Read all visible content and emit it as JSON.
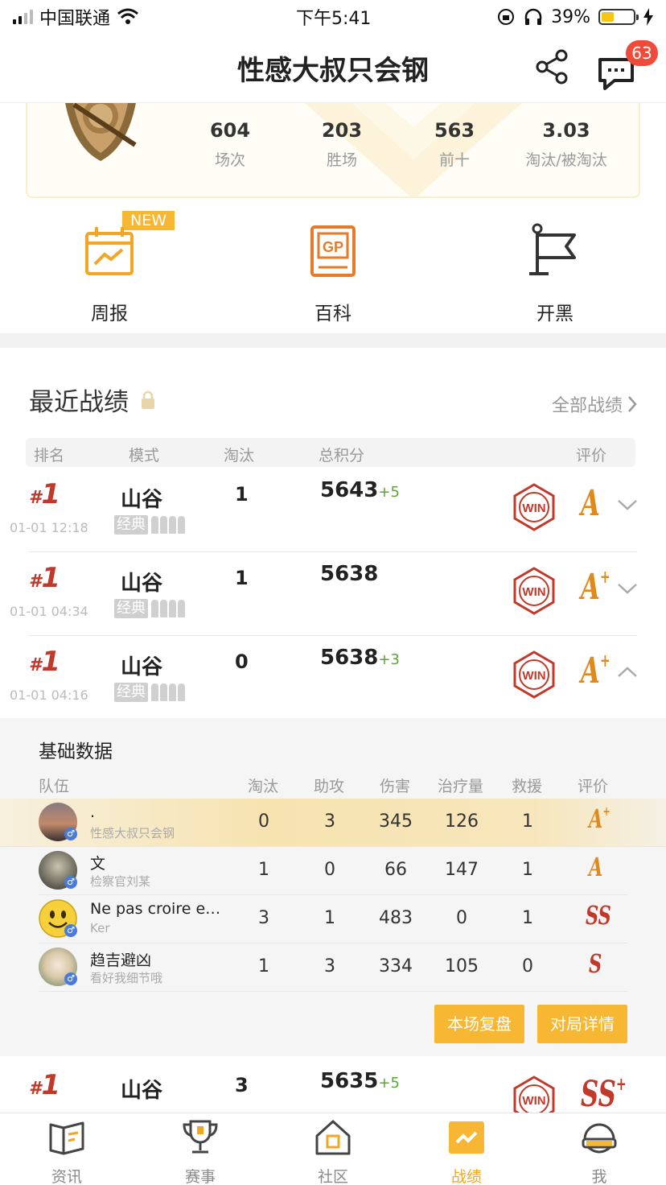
{
  "status_bar": {
    "carrier": "中国联通",
    "time": "下午5:41",
    "battery": "39%"
  },
  "header": {
    "title": "性感大叔只会钢",
    "badge_count": "63"
  },
  "stats": [
    {
      "value": "604",
      "label": "场次"
    },
    {
      "value": "203",
      "label": "胜场"
    },
    {
      "value": "563",
      "label": "前十"
    },
    {
      "value": "3.03",
      "label": "淘汰/被淘汰"
    }
  ],
  "shortcuts": {
    "new_tag": "NEW",
    "items": [
      "周报",
      "百科",
      "开黑"
    ],
    "gp_text": "GP"
  },
  "recent": {
    "title": "最近战绩",
    "all_link": "全部战绩",
    "columns": [
      "排名",
      "模式",
      "淘汰",
      "总积分",
      "评价"
    ],
    "win_text": "WIN",
    "rows": [
      {
        "rank_hash": "#",
        "rank": "1",
        "time": "01-01 12:18",
        "map": "山谷",
        "mode": "经典",
        "kills": "1",
        "score": "5643",
        "delta": "+5",
        "grade": "A",
        "grade_sup": ""
      },
      {
        "rank_hash": "#",
        "rank": "1",
        "time": "01-01 04:34",
        "map": "山谷",
        "mode": "经典",
        "kills": "1",
        "score": "5638",
        "delta": "",
        "grade": "A",
        "grade_sup": "+"
      },
      {
        "rank_hash": "#",
        "rank": "1",
        "time": "01-01 04:16",
        "map": "山谷",
        "mode": "经典",
        "kills": "0",
        "score": "5638",
        "delta": "+3",
        "grade": "A",
        "grade_sup": "+"
      },
      {
        "rank_hash": "#",
        "rank": "1",
        "time": "",
        "map": "山谷",
        "mode": "",
        "kills": "3",
        "score": "5635",
        "delta": "+5",
        "grade": "SS",
        "grade_sup": "+"
      }
    ]
  },
  "detail": {
    "title": "基础数据",
    "columns": [
      "队伍",
      "淘汰",
      "助攻",
      "伤害",
      "治疗量",
      "救援",
      "评价"
    ],
    "players": [
      {
        "name": ".",
        "id": "性感大叔只会钢",
        "kills": "0",
        "assists": "3",
        "damage": "345",
        "heal": "126",
        "rescue": "1",
        "grade": "A",
        "grade_sup": "+",
        "grade_color": "#e08a1e"
      },
      {
        "name": "文",
        "id": "检察官刘某",
        "kills": "1",
        "assists": "0",
        "damage": "66",
        "heal": "147",
        "rescue": "1",
        "grade": "A",
        "grade_sup": "",
        "grade_color": "#e08a1e"
      },
      {
        "name": "Ne pas croire e…",
        "id": "Ker",
        "kills": "3",
        "assists": "1",
        "damage": "483",
        "heal": "0",
        "rescue": "1",
        "grade": "SS",
        "grade_sup": "",
        "grade_color": "#c0392b"
      },
      {
        "name": "趋吉避凶",
        "id": "看好我细节哦",
        "kills": "1",
        "assists": "3",
        "damage": "334",
        "heal": "105",
        "rescue": "0",
        "grade": "S",
        "grade_sup": "",
        "grade_color": "#c0392b"
      }
    ],
    "replay_button": "本场复盘",
    "details_button": "对局详情"
  },
  "tabbar": [
    "资讯",
    "赛事",
    "社区",
    "战绩",
    "我"
  ],
  "colors": {
    "accent": "#f7b733",
    "rank_red": "#c0392b",
    "grade_orange": "#e08a1e",
    "delta_green": "#5aa63a"
  }
}
